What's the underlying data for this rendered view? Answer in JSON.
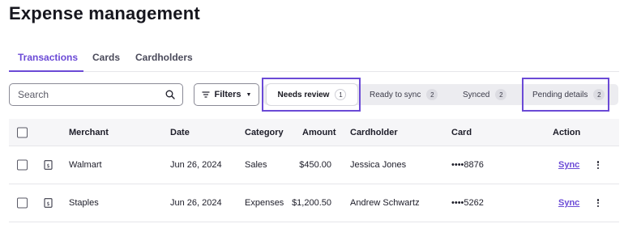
{
  "page": {
    "title": "Expense management"
  },
  "tabs": [
    {
      "label": "Transactions",
      "active": true
    },
    {
      "label": "Cards",
      "active": false
    },
    {
      "label": "Cardholders",
      "active": false
    }
  ],
  "toolbar": {
    "search_placeholder": "Search",
    "search_icon": "search-icon",
    "filters_label": "Filters",
    "filters_icon": "filter-lines-icon"
  },
  "segments": [
    {
      "label": "Needs review",
      "count": "1",
      "active": true,
      "highlighted": true
    },
    {
      "label": "Ready to sync",
      "count": "2",
      "active": false,
      "highlighted": false
    },
    {
      "label": "Synced",
      "count": "2",
      "active": false,
      "highlighted": false
    },
    {
      "label": "Pending details",
      "count": "2",
      "active": false,
      "highlighted": true
    }
  ],
  "table": {
    "headers": {
      "merchant": "Merchant",
      "date": "Date",
      "category": "Category",
      "amount": "Amount",
      "cardholder": "Cardholder",
      "card": "Card",
      "action": "Action"
    },
    "rows": [
      {
        "merchant": "Walmart",
        "date": "Jun 26, 2024",
        "category": "Sales",
        "amount": "$450.00",
        "cardholder": "Jessica Jones",
        "card": "••••8876",
        "action": "Sync"
      },
      {
        "merchant": "Staples",
        "date": "Jun 26, 2024",
        "category": "Expenses",
        "amount": "$1,200.50",
        "cardholder": "Andrew Schwartz",
        "card": "••••5262",
        "action": "Sync"
      }
    ]
  },
  "colors": {
    "accent": "#6b4ad6",
    "segment_bg": "#ececf0",
    "border": "#e6e6ea"
  }
}
